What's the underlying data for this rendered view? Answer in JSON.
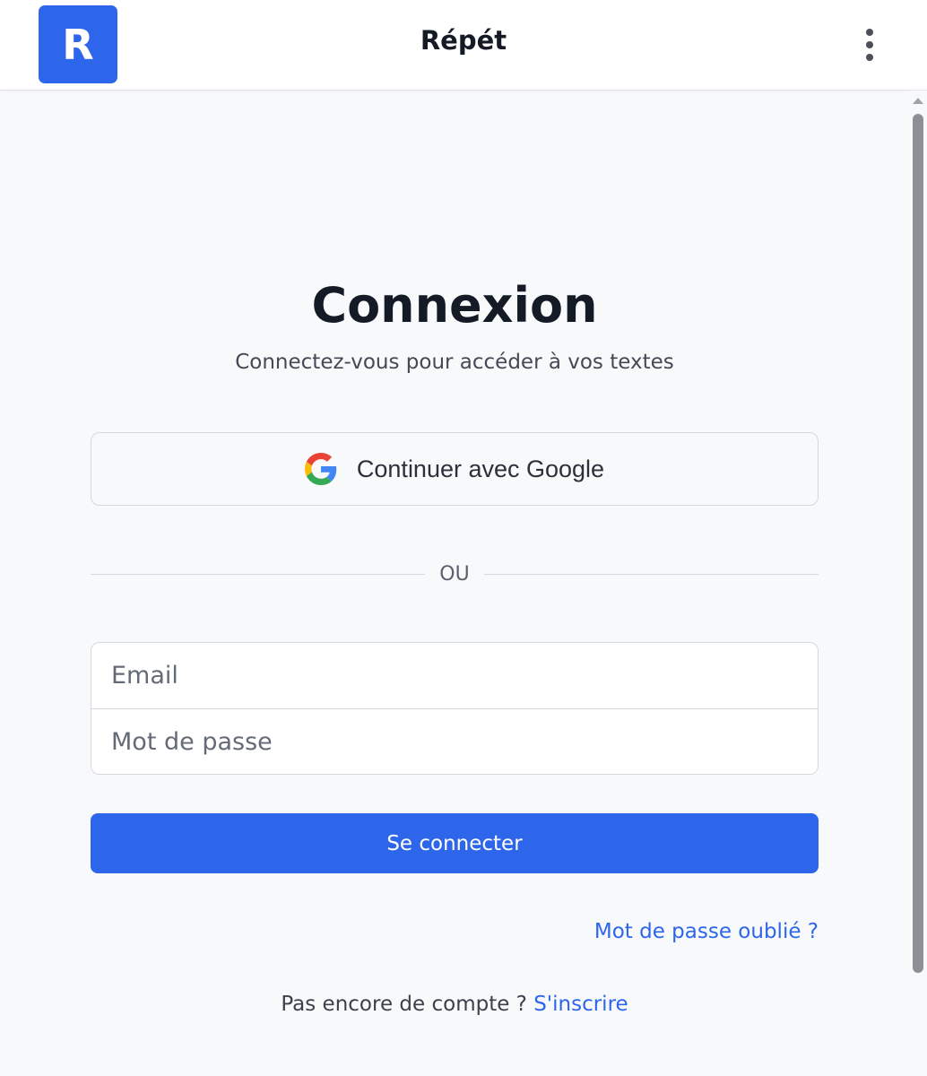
{
  "header": {
    "logo_letter": "R",
    "app_title": "Répét",
    "menu_icon": "kebab-menu-icon"
  },
  "login": {
    "title": "Connexion",
    "subtitle": "Connectez-vous pour accéder à vos textes",
    "google_button_label": "Continuer avec Google",
    "google_icon": "google-icon",
    "divider_text": "OU",
    "email_placeholder": "Email",
    "email_value": "",
    "password_placeholder": "Mot de passe",
    "password_value": "",
    "submit_label": "Se connecter",
    "forgot_password_label": "Mot de passe oublié ?",
    "signup_prompt": "Pas encore de compte ?",
    "signup_link_label": "S'inscrire"
  },
  "colors": {
    "accent": "#2d66ea",
    "background": "#f8f9fb",
    "header_background": "#ffffff",
    "title_text": "#151b26"
  }
}
